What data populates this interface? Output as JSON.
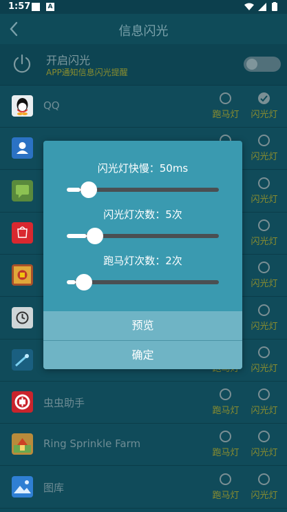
{
  "statusbar": {
    "time": "1:57",
    "notif_badge": "A"
  },
  "appbar": {
    "title": "信息闪光"
  },
  "master": {
    "title": "开启闪光",
    "subtitle": "APP通知信息闪光提醒",
    "enabled": false
  },
  "options": {
    "run_label": "跑马灯",
    "flash_label": "闪光灯"
  },
  "apps": [
    {
      "name": "QQ",
      "icon": "qq-icon",
      "run": false,
      "flash": true
    },
    {
      "name": "",
      "icon": "contacts-icon",
      "run": false,
      "flash": false
    },
    {
      "name": "",
      "icon": "messages-icon",
      "run": false,
      "flash": false
    },
    {
      "name": "",
      "icon": "huawei-store-icon",
      "run": false,
      "flash": false
    },
    {
      "name": "",
      "icon": "game-icon",
      "run": false,
      "flash": false
    },
    {
      "name": "",
      "icon": "clock-icon",
      "run": false,
      "flash": false
    },
    {
      "name": "",
      "icon": "app-icon",
      "run": false,
      "flash": false
    },
    {
      "name": "虫虫助手",
      "icon": "chongchong-icon",
      "run": false,
      "flash": false
    },
    {
      "name": "Ring Sprinkle Farm",
      "icon": "farm-icon",
      "run": false,
      "flash": false
    },
    {
      "name": "图库",
      "icon": "gallery-icon",
      "run": false,
      "flash": false
    }
  ],
  "dialog": {
    "speed_label": "闪光灯快慢：50ms",
    "speed_value": 0.09,
    "count_label": "闪光灯次数：5次",
    "count_value": 0.13,
    "run_label": "跑马灯次数：2次",
    "run_value": 0.06,
    "preview_label": "预览",
    "confirm_label": "确定"
  }
}
